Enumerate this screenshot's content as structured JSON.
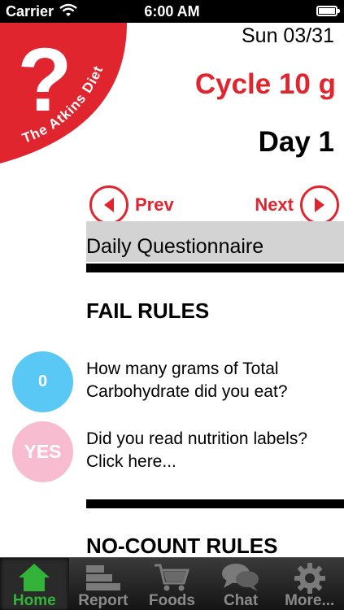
{
  "status_bar": {
    "carrier": "Carrier",
    "time": "6:00 AM"
  },
  "logo": {
    "mark": "?",
    "text": "The Atkins Diet",
    "color": "#e0252f"
  },
  "header": {
    "date": "Sun 03/31",
    "cycle": "Cycle 10 g",
    "day": "Day 1"
  },
  "nav": {
    "prev_label": "Prev",
    "next_label": "Next"
  },
  "section": {
    "title": "Daily Questionnaire"
  },
  "fail_rules": {
    "heading": "FAIL RULES",
    "questions": [
      {
        "answer": "0",
        "text": "How many grams of Total Carbohydrate did you eat?",
        "color": "#5ac8f5"
      },
      {
        "answer": "YES",
        "text": "Did you read nutrition labels? Click here...",
        "color": "#f8bcd0"
      }
    ]
  },
  "no_count_rules": {
    "heading": "NO-COUNT RULES"
  },
  "tab_bar": {
    "tabs": [
      {
        "label": "Home",
        "icon": "home-icon",
        "active": true
      },
      {
        "label": "Report",
        "icon": "report-icon",
        "active": false
      },
      {
        "label": "Foods",
        "icon": "cart-icon",
        "active": false
      },
      {
        "label": "Chat",
        "icon": "chat-icon",
        "active": false
      },
      {
        "label": "More...",
        "icon": "gear-icon",
        "active": false
      }
    ]
  },
  "colors": {
    "accent": "#e0252f",
    "active_tab": "#33b33a"
  }
}
